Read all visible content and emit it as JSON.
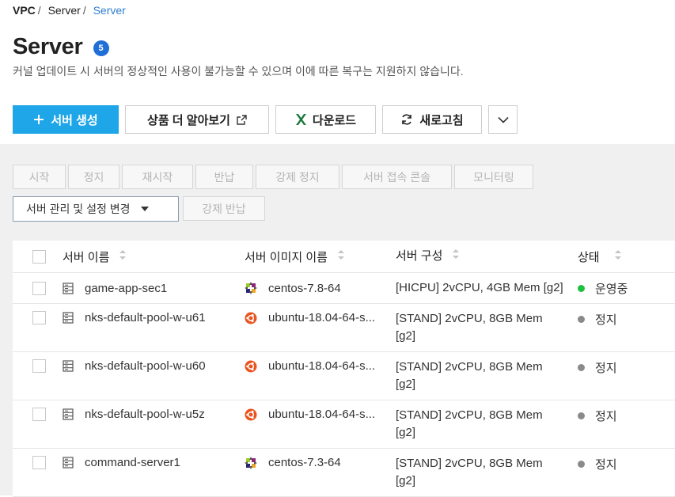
{
  "breadcrumb": {
    "items": [
      "VPC",
      "Server",
      "Server"
    ]
  },
  "page": {
    "title": "Server",
    "count": "5",
    "notice": "커널 업데이트 시 서버의 정상적인 사용이 불가능할 수 있으며 이에 따른 복구는 지원하지 않습니다."
  },
  "toolbar": {
    "create_label": "서버 생성",
    "learn_more_label": "상품 더 알아보기",
    "download_label": "다운로드",
    "refresh_label": "새로고침",
    "accent": "#1ea6e8"
  },
  "actions": {
    "start": "시작",
    "stop": "정지",
    "restart": "재시작",
    "return": "반납",
    "force_stop": "강제 정지",
    "console": "서버 접속 콘솔",
    "monitoring": "모니터링",
    "manage": "서버 관리 및 설정 변경",
    "force_return": "강제 반납"
  },
  "table": {
    "headers": {
      "name": "서버 이름",
      "image": "서버 이미지 이름",
      "spec": "서버 구성",
      "status": "상태"
    },
    "rows": [
      {
        "name": "game-app-sec1",
        "os": "centos-icon",
        "image": "centos-7.8-64",
        "spec_line1": "[HICPU] 2vCPU, 4GB Mem [g2]",
        "spec_line2": "",
        "status": "운영중",
        "status_color": "#1fbf3f"
      },
      {
        "name": "nks-default-pool-w-u61",
        "os": "ubuntu-icon",
        "image": "ubuntu-18.04-64-s...",
        "spec_line1": "[STAND] 2vCPU, 8GB Mem",
        "spec_line2": "[g2]",
        "status": "정지",
        "status_color": "#8a8a8a"
      },
      {
        "name": "nks-default-pool-w-u60",
        "os": "ubuntu-icon",
        "image": "ubuntu-18.04-64-s...",
        "spec_line1": "[STAND] 2vCPU, 8GB Mem",
        "spec_line2": "[g2]",
        "status": "정지",
        "status_color": "#8a8a8a"
      },
      {
        "name": "nks-default-pool-w-u5z",
        "os": "ubuntu-icon",
        "image": "ubuntu-18.04-64-s...",
        "spec_line1": "[STAND] 2vCPU, 8GB Mem",
        "spec_line2": "[g2]",
        "status": "정지",
        "status_color": "#8a8a8a"
      },
      {
        "name": "command-server1",
        "os": "centos-icon",
        "image": "centos-7.3-64",
        "spec_line1": "[STAND] 2vCPU, 8GB Mem",
        "spec_line2": "[g2]",
        "status": "정지",
        "status_color": "#8a8a8a"
      }
    ]
  }
}
